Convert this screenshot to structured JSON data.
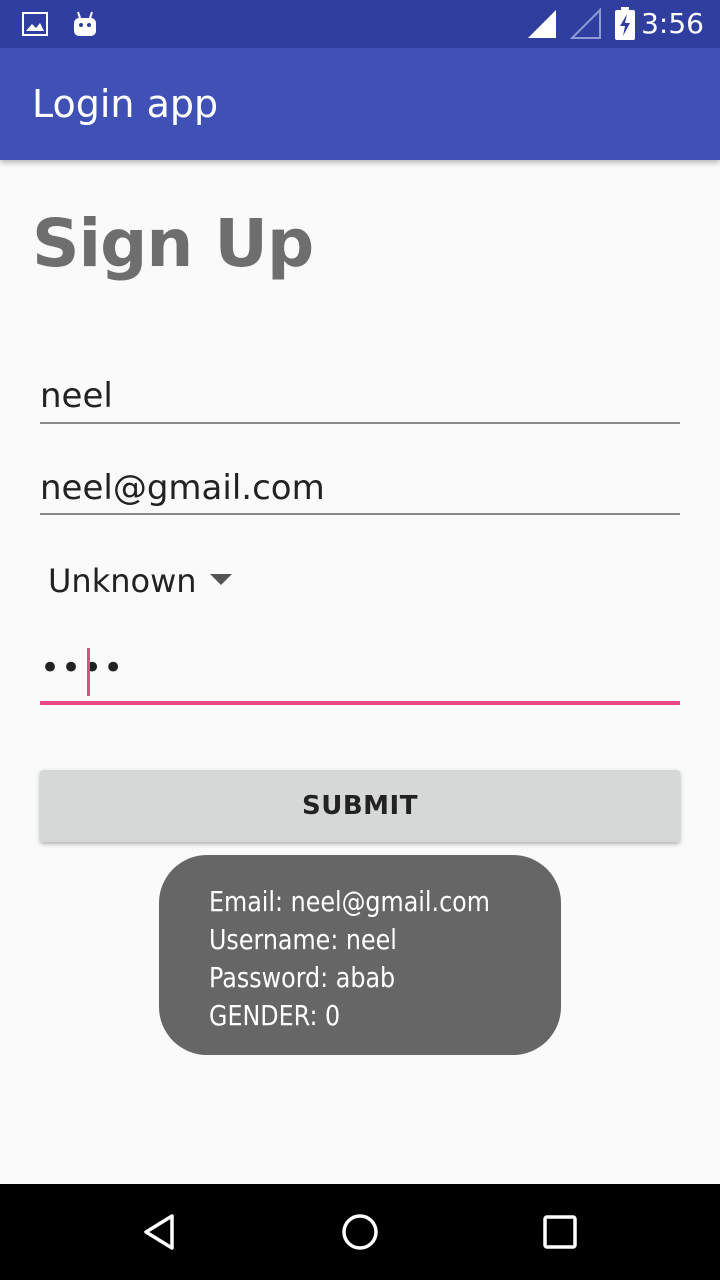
{
  "status_bar": {
    "time": "3:56",
    "icons": [
      "image-icon",
      "android-icon",
      "signal-icon",
      "signal-empty-icon",
      "battery-charging-icon"
    ]
  },
  "app_bar": {
    "title": "Login app"
  },
  "form": {
    "title": "Sign Up",
    "username_value": "neel",
    "email_value": "neel@gmail.com",
    "gender_selected": "Unknown",
    "password_masked": "••••",
    "submit_label": "SUBMIT"
  },
  "toast": {
    "lines": [
      "Email: neel@gmail.com",
      "Username: neel",
      "Password: abab",
      "GENDER: 0"
    ]
  },
  "nav_bar": {
    "icons": [
      "back-icon",
      "home-icon",
      "recents-icon"
    ]
  },
  "colors": {
    "status_bar": "#303f9f",
    "app_bar": "#3f51b5",
    "accent": "#e94a83",
    "toast_bg": "#666666"
  }
}
